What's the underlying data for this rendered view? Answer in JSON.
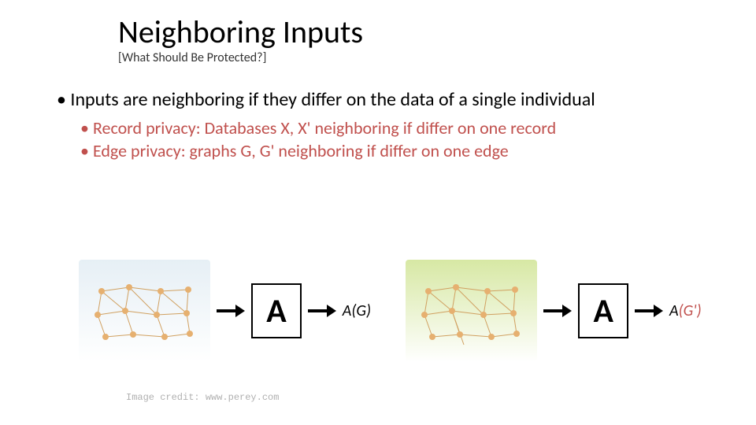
{
  "title": "Neighboring Inputs",
  "subtitle": "[What Should Be Protected?]",
  "bullet_main": "Inputs are neighboring if they differ on the data of a single individual",
  "bullet_sub1": "Record privacy: Databases X, X' neighboring if differ on one record",
  "bullet_sub2": "Edge privacy: graphs G, G' neighboring if differ on one edge",
  "diagram": {
    "box_label": "A",
    "output_left_a": "A",
    "output_left_g": "(G)",
    "output_right_a": "A",
    "output_right_g": "(G')"
  },
  "credit": "Image credit: www.perey.com"
}
